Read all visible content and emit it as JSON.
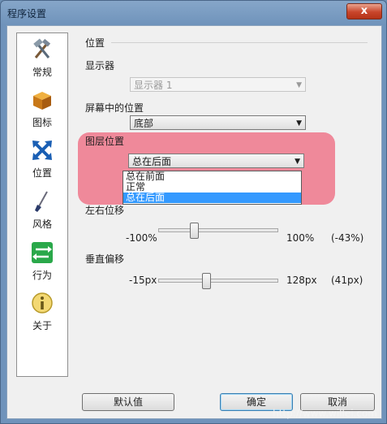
{
  "window": {
    "title": "程序设置",
    "close_label": "x"
  },
  "sidebar": {
    "items": [
      {
        "label": "常规",
        "icon": "hammer-icon"
      },
      {
        "label": "图标",
        "icon": "box-icon"
      },
      {
        "label": "位置",
        "icon": "arrows-icon"
      },
      {
        "label": "风格",
        "icon": "brush-icon"
      },
      {
        "label": "行为",
        "icon": "exchange-icon"
      },
      {
        "label": "关于",
        "icon": "info-icon"
      }
    ]
  },
  "main": {
    "section_title": "位置",
    "display": {
      "label": "显示器",
      "value": "显示器 1"
    },
    "screen_position": {
      "label": "屏幕中的位置",
      "value": "底部"
    },
    "layer_position": {
      "label": "图层位置",
      "value": "总在后面",
      "options": [
        "总在前面",
        "正常",
        "总在后面"
      ]
    },
    "horizontal_offset": {
      "label": "左右位移",
      "min": "-100%",
      "max": "100%",
      "current": "(-43%)"
    },
    "vertical_offset": {
      "label": "垂直偏移",
      "min": "-15px",
      "max": "128px",
      "current": "(41px)"
    }
  },
  "footer": {
    "default_label": "默认值",
    "ok_label": "确定",
    "cancel_label": "取消"
  },
  "watermark": "http://www.willei.com"
}
